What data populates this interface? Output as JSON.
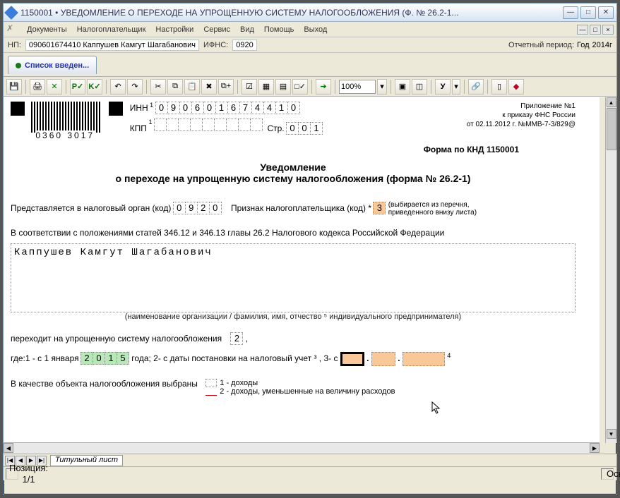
{
  "window": {
    "title": "1150001 • УВЕДОМЛЕНИЕ О ПЕРЕХОДЕ НА УПРОЩЕННУЮ СИСТЕМУ НАЛОГООБЛОЖЕНИЯ (Ф. № 26.2-1...",
    "min": "—",
    "max": "□",
    "close": "✕"
  },
  "menu": {
    "documents": "Документы",
    "taxpayer": "Налогоплательщик",
    "settings": "Настройки",
    "service": "Сервис",
    "view": "Вид",
    "help": "Помощь",
    "exit": "Выход"
  },
  "infobar": {
    "np_label": "НП:",
    "np_value": "090601674410 Каппушев Камгут Шагабанович",
    "ifns_label": "ИФНС:",
    "ifns_value": "0920",
    "period_label": "Отчетный период:",
    "period_unit": "Год",
    "period_value": "2014г"
  },
  "tabstrip": {
    "tab1": "Список введен..."
  },
  "toolbar": {
    "save": "💾",
    "print": "🖨",
    "excel": "✕",
    "recalcP": "P✓",
    "recalcK": "K✓",
    "undo": "↶",
    "redo": "↷",
    "cut": "✂",
    "copy": "⧉",
    "paste": "📋",
    "del": "✖",
    "dup": "⧉+",
    "f1": "☑",
    "f2": "▦",
    "f3": "▤",
    "f4": "□✓",
    "go": "➔",
    "zoom": "100%",
    "zoomarrow": "▾",
    "c1": "▣",
    "c2": "◫",
    "u": "У",
    "udrop": "▾",
    "r1": "🔗",
    "r2": "▯",
    "help": "◆"
  },
  "doc": {
    "barcode_num": "0360 3017",
    "inn_label": "ИНН",
    "inn": [
      "0",
      "9",
      "0",
      "6",
      "0",
      "1",
      "6",
      "7",
      "4",
      "4",
      "1",
      "0"
    ],
    "kpp_label": "КПП",
    "kpp": [
      "",
      "",
      "",
      "",
      "",
      "",
      "",
      "",
      ""
    ],
    "page_label": "Стр.",
    "page": [
      "0",
      "0",
      "1"
    ],
    "annex_l1": "Приложение №1",
    "annex_l2": "к приказу ФНС России",
    "annex_l3": "от 02.11.2012 г. №ММВ-7-3/829@",
    "form_knd": "Форма по КНД 1150001",
    "title_l1": "Уведомление",
    "title_l2": "о переходе на упрощенную систему налогообложения (форма № 26.2-1)",
    "org_label": "Представляется в налоговый орган  (код)",
    "org_code": [
      "0",
      "9",
      "2",
      "0"
    ],
    "sign_label": "Признак налогоплательщика  (код)",
    "sign_value": "3",
    "sign_hint_l1": "(выбирается из перечня,",
    "sign_hint_l2": "приведенного внизу листа)",
    "basis": "В соответствии с положениями статей 346.12 и 346.13 главы 26.2 Налогового кодекса Российской Федерации",
    "name": "Каппушев Камгут Шагабанович",
    "name_hint": "(наименование организации / фамилия, имя, отчество ⁵ индивидуального предпринимателя)",
    "transition": "переходит на упрощенную систему налогообложения",
    "transition_val": "2",
    "when_pref": "где:1 - с 1 января",
    "year": [
      "2",
      "0",
      "1",
      "5"
    ],
    "when_mid": "года;   2- с даты постановки на налоговый учет ³ ,   3- с",
    "obj_label": "В качестве объекта налогообложения выбраны",
    "obj_opt1": "1 - доходы",
    "obj_opt2": "2 - доходы, уменьшенные на величину расходов"
  },
  "pagectrl": {
    "tab": "Титульный лист"
  },
  "status": {
    "pos": "Позиция: 1/1",
    "mode": "Основной"
  }
}
